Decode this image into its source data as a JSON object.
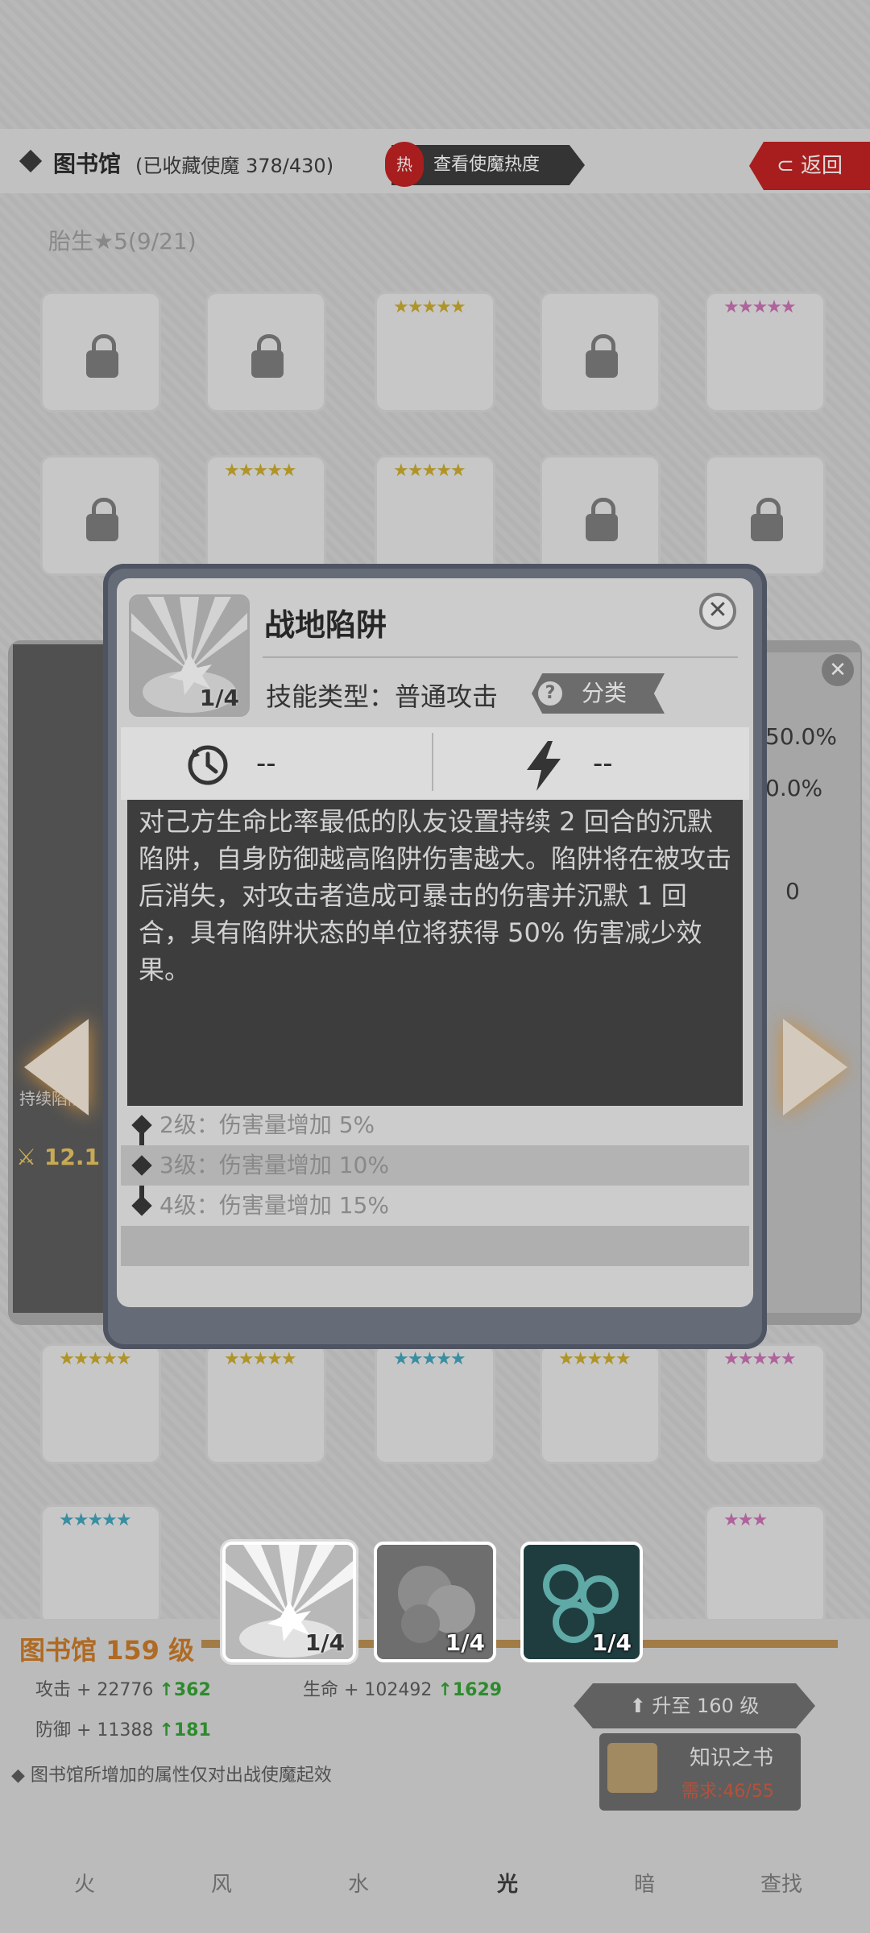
{
  "library": {
    "title": "图书馆",
    "count": "(已收藏使魔 378/430)",
    "hot_button": "查看使魔热度",
    "hot_badge": "热",
    "back_button": "返回",
    "section_label": "胎生★5(9/21)"
  },
  "side_panel": {
    "right_values": [
      "50.0%",
      "0.0%",
      "0"
    ],
    "left_stat": "12.1",
    "left_label": "持续陷阱"
  },
  "modal": {
    "title": "战地陷阱",
    "icon_level": "1/4",
    "skill_type_label": "技能类型：",
    "skill_type_value": "普通攻击",
    "category_tag": "分类",
    "cooldown_value": "--",
    "energy_value": "--",
    "description": "对己方生命比率最低的队友设置持续 2 回合的沉默陷阱，自身防御越高陷阱伤害越大。陷阱将在被攻击后消失，对攻击者造成可暴击的伤害并沉默 1 回合，具有陷阱状态的单位将获得 50% 伤害减少效果。",
    "levels": [
      {
        "text": "2级：伤害量增加 5%"
      },
      {
        "text": "3级：伤害量增加 10%"
      },
      {
        "text": "4级：伤害量增加 15%"
      }
    ]
  },
  "skills": [
    {
      "level": "1/4"
    },
    {
      "level": "1/4"
    },
    {
      "level": "1/4"
    }
  ],
  "bottom": {
    "library_level": "图书馆 159 级",
    "attack": "攻击 + 22776",
    "attack_inc": "362",
    "hp": "生命 + 102492",
    "hp_inc": "1629",
    "defense": "防御 + 11388",
    "defense_inc": "181",
    "upgrade_button": "升至 160 级",
    "book_name": "知识之书",
    "book_need": "需求:46/55",
    "note": "图书馆所增加的属性仅对出战使魔起效",
    "tabs": [
      "火",
      "风",
      "水",
      "光",
      "暗",
      "查找"
    ]
  },
  "colors": {
    "accent_red": "#c01818",
    "modal_frame": "#6f7686",
    "desc_bg": "#3d3d3d"
  }
}
